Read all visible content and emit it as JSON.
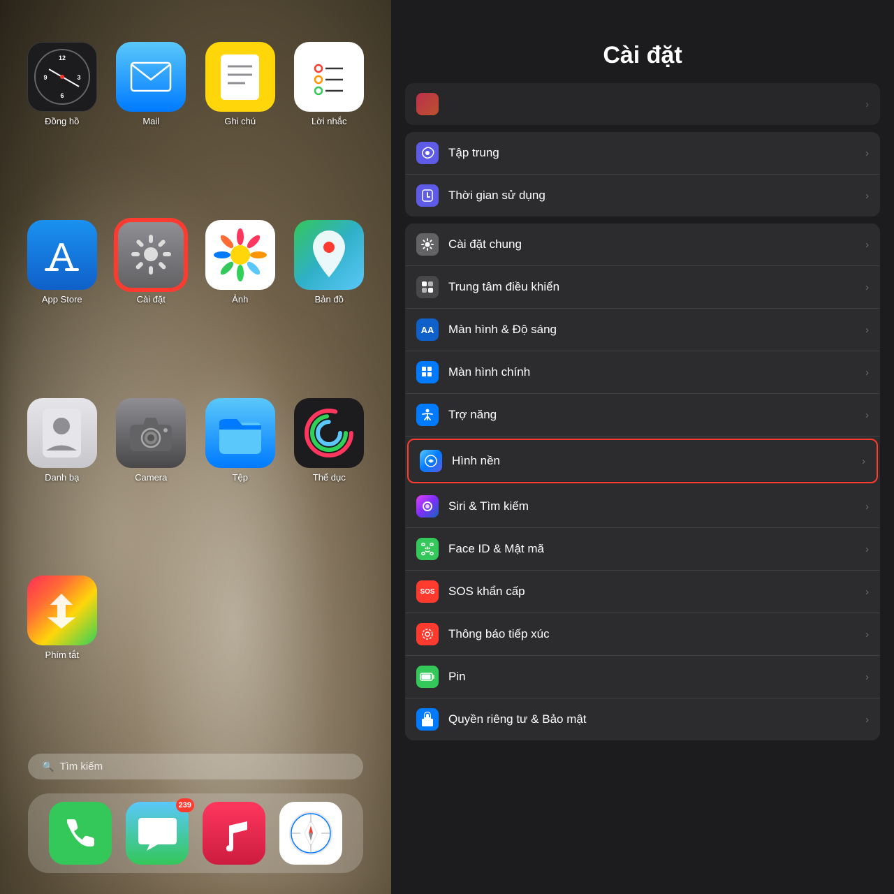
{
  "left": {
    "apps": [
      {
        "id": "clock",
        "label": "Đồng hồ",
        "icon_type": "clock"
      },
      {
        "id": "mail",
        "label": "Mail",
        "icon_type": "mail"
      },
      {
        "id": "notes",
        "label": "Ghi chú",
        "icon_type": "notes"
      },
      {
        "id": "reminders",
        "label": "Lời nhắc",
        "icon_type": "reminders"
      },
      {
        "id": "appstore",
        "label": "App Store",
        "icon_type": "appstore"
      },
      {
        "id": "settings",
        "label": "Cài đặt",
        "icon_type": "settings",
        "highlighted": true
      },
      {
        "id": "photos",
        "label": "Ảnh",
        "icon_type": "photos"
      },
      {
        "id": "maps",
        "label": "Bản đồ",
        "icon_type": "maps"
      },
      {
        "id": "contacts",
        "label": "Danh bạ",
        "icon_type": "contacts"
      },
      {
        "id": "camera",
        "label": "Camera",
        "icon_type": "camera"
      },
      {
        "id": "files",
        "label": "Tệp",
        "icon_type": "files"
      },
      {
        "id": "fitness",
        "label": "Thể dục",
        "icon_type": "fitness"
      },
      {
        "id": "shortcuts",
        "label": "Phím tắt",
        "icon_type": "shortcuts"
      }
    ],
    "search_placeholder": "Tìm kiếm",
    "dock": [
      {
        "id": "phone",
        "icon_type": "phone"
      },
      {
        "id": "messages",
        "icon_type": "messages",
        "badge": "239"
      },
      {
        "id": "music",
        "icon_type": "music"
      },
      {
        "id": "safari",
        "icon_type": "safari"
      }
    ]
  },
  "right": {
    "title": "Cài đặt",
    "sections": [
      {
        "id": "top-partial",
        "rows": [
          {
            "id": "partial",
            "icon_bg": "bg-pink",
            "icon": "❤️",
            "label": "",
            "partial": true
          }
        ]
      },
      {
        "id": "focus-section",
        "rows": [
          {
            "id": "focus",
            "icon_bg": "bg-purple",
            "icon": "🌙",
            "label": "Tập trung"
          },
          {
            "id": "screen-time",
            "icon_bg": "bg-purple",
            "icon": "⏳",
            "label": "Thời gian sử dụng"
          }
        ]
      },
      {
        "id": "general-section",
        "rows": [
          {
            "id": "general",
            "icon_bg": "bg-gray",
            "icon": "⚙️",
            "label": "Cài đặt chung"
          },
          {
            "id": "control-center",
            "icon_bg": "bg-dark-gray",
            "icon": "🎛",
            "label": "Trung tâm điều khiển"
          },
          {
            "id": "display",
            "icon_bg": "bg-blue2",
            "icon": "AA",
            "label": "Màn hình & Độ sáng"
          },
          {
            "id": "home-screen",
            "icon_bg": "bg-blue",
            "icon": "⊞",
            "label": "Màn hình chính"
          },
          {
            "id": "accessibility",
            "icon_bg": "bg-blue",
            "icon": "♿",
            "label": "Trợ năng"
          },
          {
            "id": "wallpaper",
            "icon_bg": "bg-wallpaper",
            "icon": "✿",
            "label": "Hình nền",
            "highlighted": true
          },
          {
            "id": "siri",
            "icon_bg": "bg-siri",
            "icon": "◉",
            "label": "Siri & Tìm kiếm"
          },
          {
            "id": "face-id",
            "icon_bg": "bg-face-id",
            "icon": "😊",
            "label": "Face ID & Mật mã"
          },
          {
            "id": "sos",
            "icon_bg": "bg-red",
            "icon": "SOS",
            "label": "SOS khẩn cấp"
          },
          {
            "id": "exposure",
            "icon_bg": "bg-red",
            "icon": "◎",
            "label": "Thông báo tiếp xúc"
          },
          {
            "id": "battery",
            "icon_bg": "bg-green",
            "icon": "🔋",
            "label": "Pin"
          },
          {
            "id": "privacy",
            "icon_bg": "bg-blue",
            "icon": "✋",
            "label": "Quyền riêng tư & Bảo mật"
          }
        ]
      }
    ]
  }
}
